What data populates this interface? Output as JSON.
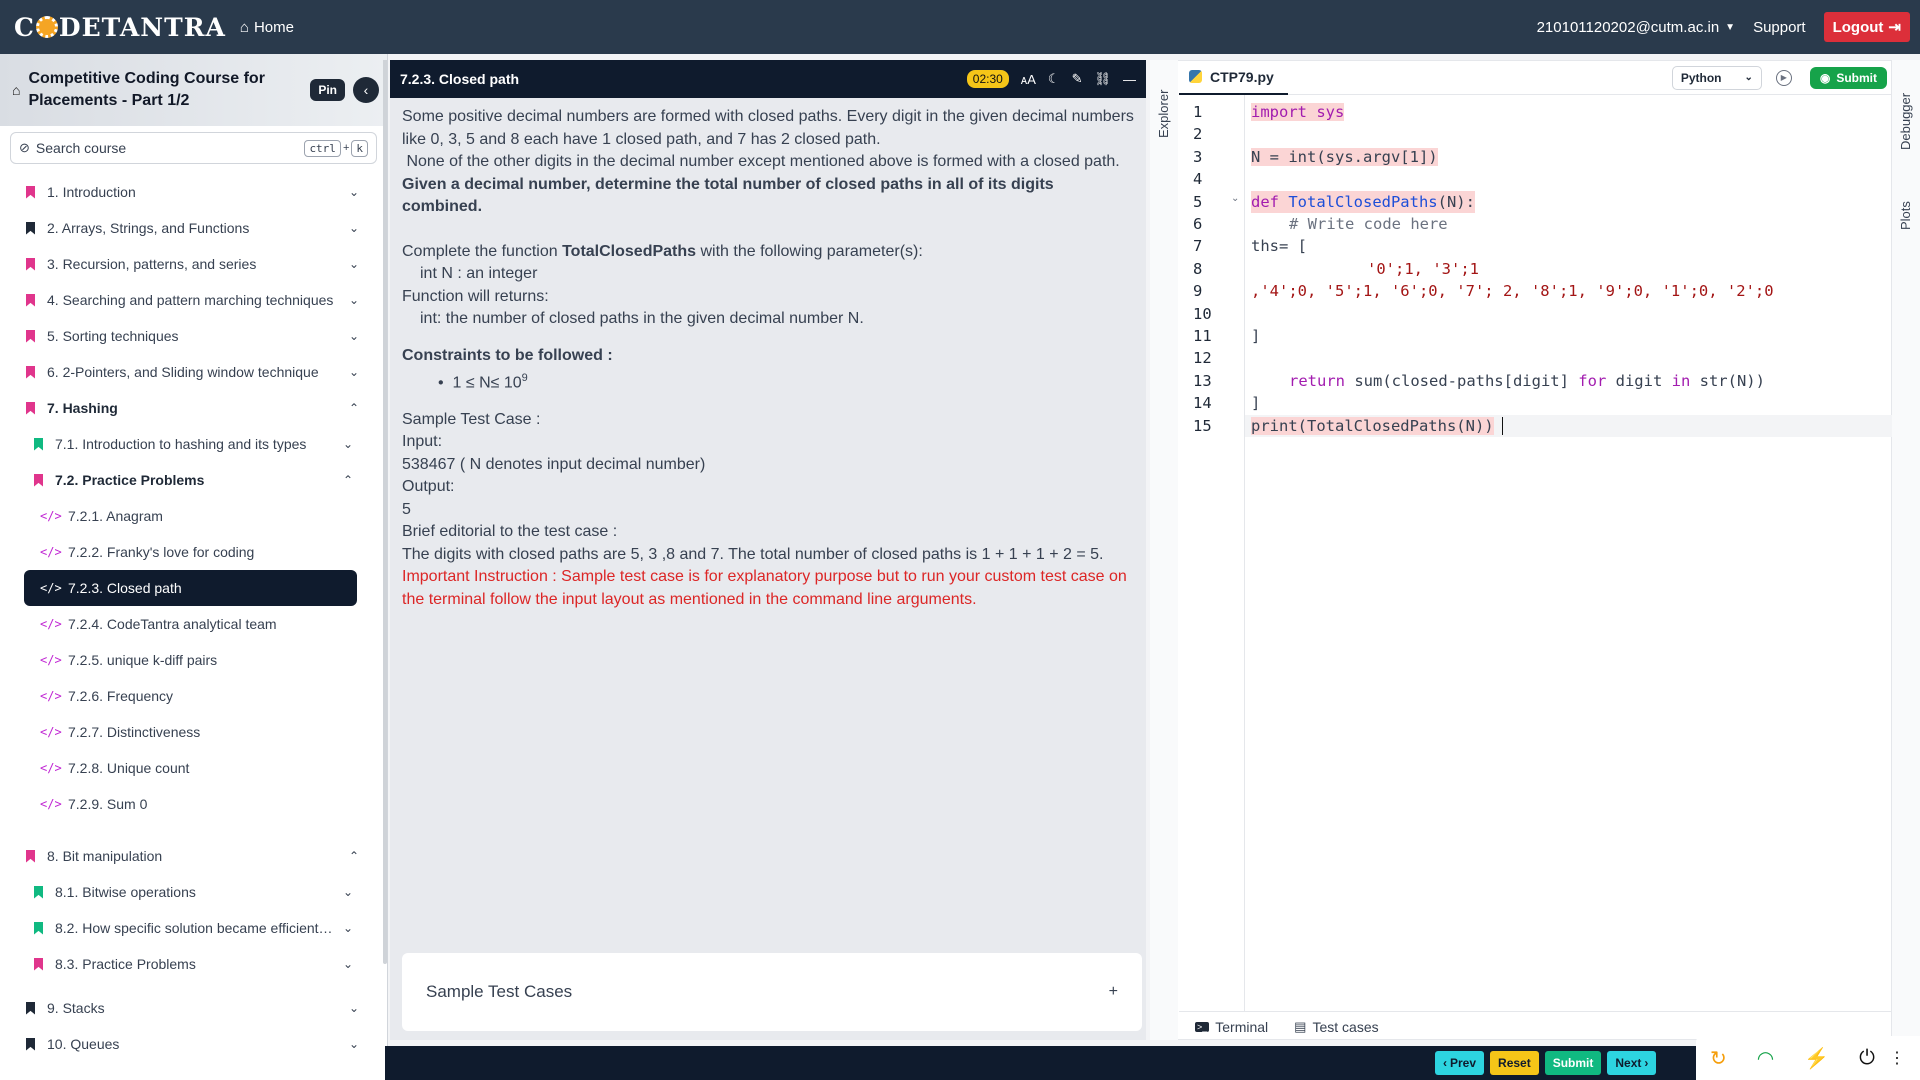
{
  "topbar": {
    "logo": "CODETANTRA",
    "home_label": "Home",
    "user": "210101120202@cutm.ac.in",
    "support_label": "Support",
    "logout_label": "Logout"
  },
  "sidebar": {
    "course_title": "Competitive Coding Course for Placements - Part 1/2",
    "pin_label": "Pin",
    "search_placeholder": "Search course",
    "shortcut_ctrl": "ctrl",
    "shortcut_plus": "+",
    "shortcut_key": "k",
    "sections": [
      {
        "label": "1. Introduction",
        "color": "#e0358c"
      },
      {
        "label": "2. Arrays, Strings, and Functions",
        "color": "#1f2937"
      },
      {
        "label": "3. Recursion, patterns, and series",
        "color": "#e0358c"
      },
      {
        "label": "4. Searching and pattern marching techniques",
        "color": "#e0358c"
      },
      {
        "label": "5. Sorting techniques",
        "color": "#e0358c"
      },
      {
        "label": "6. 2-Pointers, and Sliding window technique",
        "color": "#e0358c"
      },
      {
        "label": "7. Hashing",
        "color": "#e0358c"
      }
    ],
    "hashing_subs": [
      {
        "label": "7.1. Introduction to hashing and its types",
        "color": "#10b981"
      },
      {
        "label": "7.2. Practice Problems",
        "color": "#e0358c"
      }
    ],
    "problems": [
      "7.2.1. Anagram",
      "7.2.2. Franky's love for coding",
      "7.2.3. Closed path",
      "7.2.4. CodeTantra analytical team",
      "7.2.5. unique k-diff pairs",
      "7.2.6. Frequency",
      "7.2.7. Distinctiveness",
      "7.2.8. Unique count",
      "7.2.9. Sum 0"
    ],
    "section8": {
      "label": "8. Bit manipulation",
      "color": "#e0358c"
    },
    "bit_subs": [
      {
        "label": "8.1. Bitwise operations",
        "color": "#10b981"
      },
      {
        "label": "8.2. How specific solution became efficient…",
        "color": "#10b981"
      },
      {
        "label": "8.3. Practice Problems",
        "color": "#e0358c"
      }
    ],
    "section9": {
      "label": "9. Stacks",
      "color": "#1f2937"
    },
    "section10": {
      "label": "10. Queues",
      "color": "#1f2937"
    }
  },
  "problem": {
    "title": "7.2.3. Closed path",
    "timer": "02:30",
    "text": {
      "p1": "Some positive decimal numbers are formed with closed paths. Every digit in the given decimal numbers like 0, 3, 5 and 8 each have 1 closed path, and 7 has 2 closed path.",
      "p2": " None of the other digits in the decimal number except mentioned above is formed with a closed path.",
      "p3": "Given a decimal number, determine the total number of closed paths in all of its digits combined.",
      "p4a": "Complete the function ",
      "p4b": "TotalClosedPaths",
      "p4c": " with the following parameter(s):",
      "param": "int N : an integer",
      "returns_hdr": "Function will returns:",
      "returns": "int: the number of closed paths in the given decimal number N.",
      "constraints_hdr": "Constraints to be followed :",
      "constraint": "1 ≤ N≤ 10",
      "constraint_sup": "9",
      "sample_hdr": "Sample Test Case :",
      "input_hdr": "Input:",
      "input": "538467 ( N denotes input decimal number)",
      "output_hdr": "Output:",
      "output": "5",
      "editorial_hdr": "Brief editorial to the test case :",
      "editorial": "The digits with closed paths are 5, 3 ,8 and 7. The total number of closed paths is 1 + 1 + 1 + 2 = 5.",
      "important": "Important Instruction : Sample test case is for explanatory purpose but to run your custom test case on the terminal follow the input layout as mentioned in the command line arguments."
    },
    "sample_cases_label": "Sample Test Cases",
    "sample_cases_toggle": "+"
  },
  "editor": {
    "explorer_label": "Explorer",
    "debugger_label": "Debugger",
    "plots_label": "Plots",
    "file_name": "CTP79.py",
    "language": "Python",
    "submit_label": "Submit",
    "line_numbers": [
      "1",
      "2",
      "3",
      "4",
      "5",
      "6",
      "7",
      "8",
      "9",
      "10",
      "11",
      "12",
      "13",
      "14",
      "15"
    ],
    "code": {
      "l1": "import sys",
      "l3": "N = int(sys.argv[1])",
      "l5a": "def ",
      "l5b": "TotalClosedPaths",
      "l5c": "(N):",
      "l6": "# Write code here",
      "l7": "ths= [",
      "l8": "'0';1, '3';1",
      "l9": ",'4';0, '5';1, '6';0, '7'; 2, '8';1, '9';0, '1';0, '2';0",
      "l11": "]",
      "l13a": "return",
      "l13b": " sum(closed-paths[digit] ",
      "l13c": "for",
      "l13d": " digit ",
      "l13e": "in",
      "l13f": " str(N))",
      "l14": "]",
      "l15": "print(TotalClosedPaths(N))"
    },
    "terminal_label": "Terminal",
    "testcases_label": "Test cases"
  },
  "bottombar": {
    "prev_label": "Prev",
    "reset_label": "Reset",
    "submit_label": "Submit",
    "next_label": "Next"
  }
}
